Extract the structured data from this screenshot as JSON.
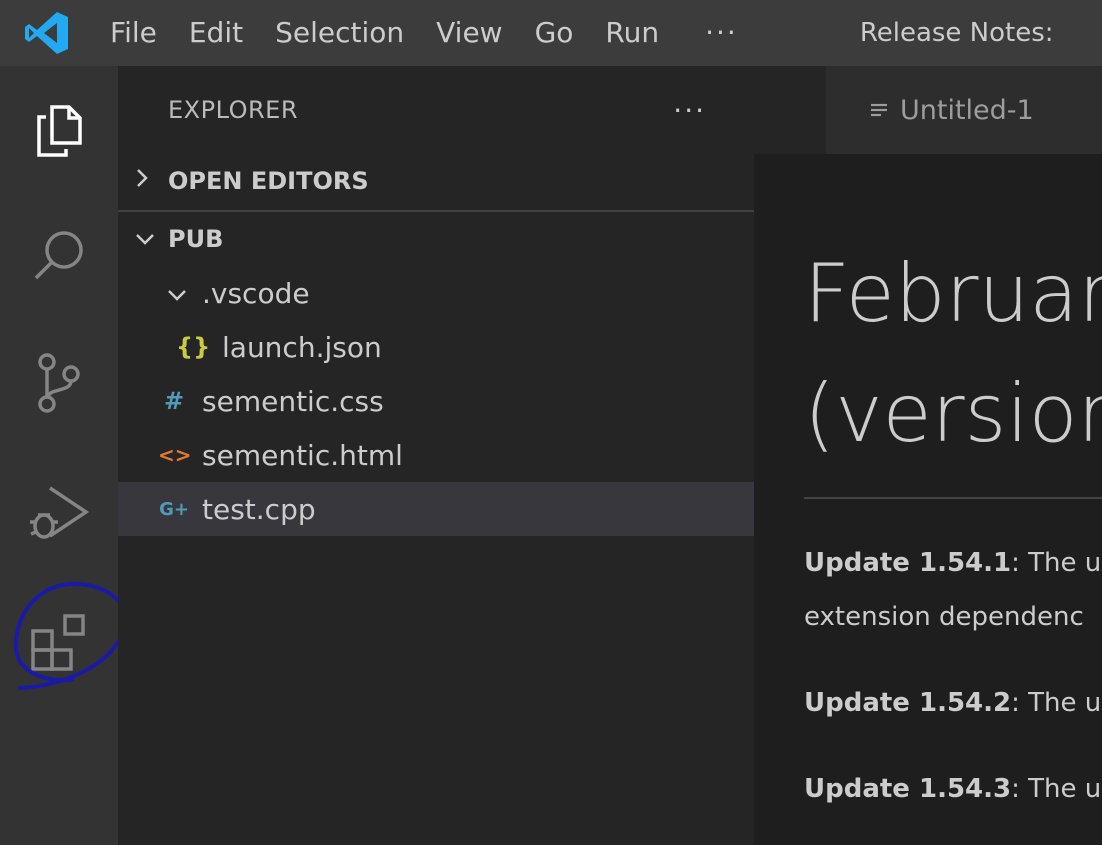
{
  "titlebar": {
    "menu": [
      "File",
      "Edit",
      "Selection",
      "View",
      "Go",
      "Run"
    ],
    "more": "···",
    "window_title": "Release Notes:"
  },
  "sidebar": {
    "title": "EXPLORER",
    "more": "···",
    "open_editors": "OPEN EDITORS",
    "folder": "PUB",
    "tree": [
      {
        "label": ".vscode",
        "icon": "chevron-down-icon",
        "glyph": "∨"
      },
      {
        "label": "launch.json",
        "icon": "json-file-icon",
        "glyph": "{}"
      },
      {
        "label": "sementic.css",
        "icon": "css-file-icon",
        "glyph": "#"
      },
      {
        "label": "sementic.html",
        "icon": "html-file-icon",
        "glyph": "<>"
      },
      {
        "label": "test.cpp",
        "icon": "cpp-file-icon",
        "glyph": "G+"
      }
    ]
  },
  "editor": {
    "tab_label": "Untitled-1",
    "heading_line1": "Februar",
    "heading_line2": "(versior",
    "updates": [
      {
        "label": "Update 1.54.1",
        "text": ": The u"
      },
      {
        "label": "",
        "text": "extension dependenc"
      },
      {
        "label": "Update 1.54.2",
        "text": ": The u"
      },
      {
        "label": "Update 1.54.3",
        "text": ": The u"
      }
    ]
  },
  "colors": {
    "titlebar": "#3c3c3c",
    "activitybar": "#333333",
    "sidebar": "#252526",
    "editor": "#1e1e1e",
    "selected_row": "#37373d",
    "vscode_blue": "#23a9f2",
    "json_yellow": "#cbcb41",
    "css_blue": "#519aba",
    "html_orange": "#e37933",
    "cpp_blue": "#519aba",
    "annotation_ink": "#1a1aa8"
  }
}
